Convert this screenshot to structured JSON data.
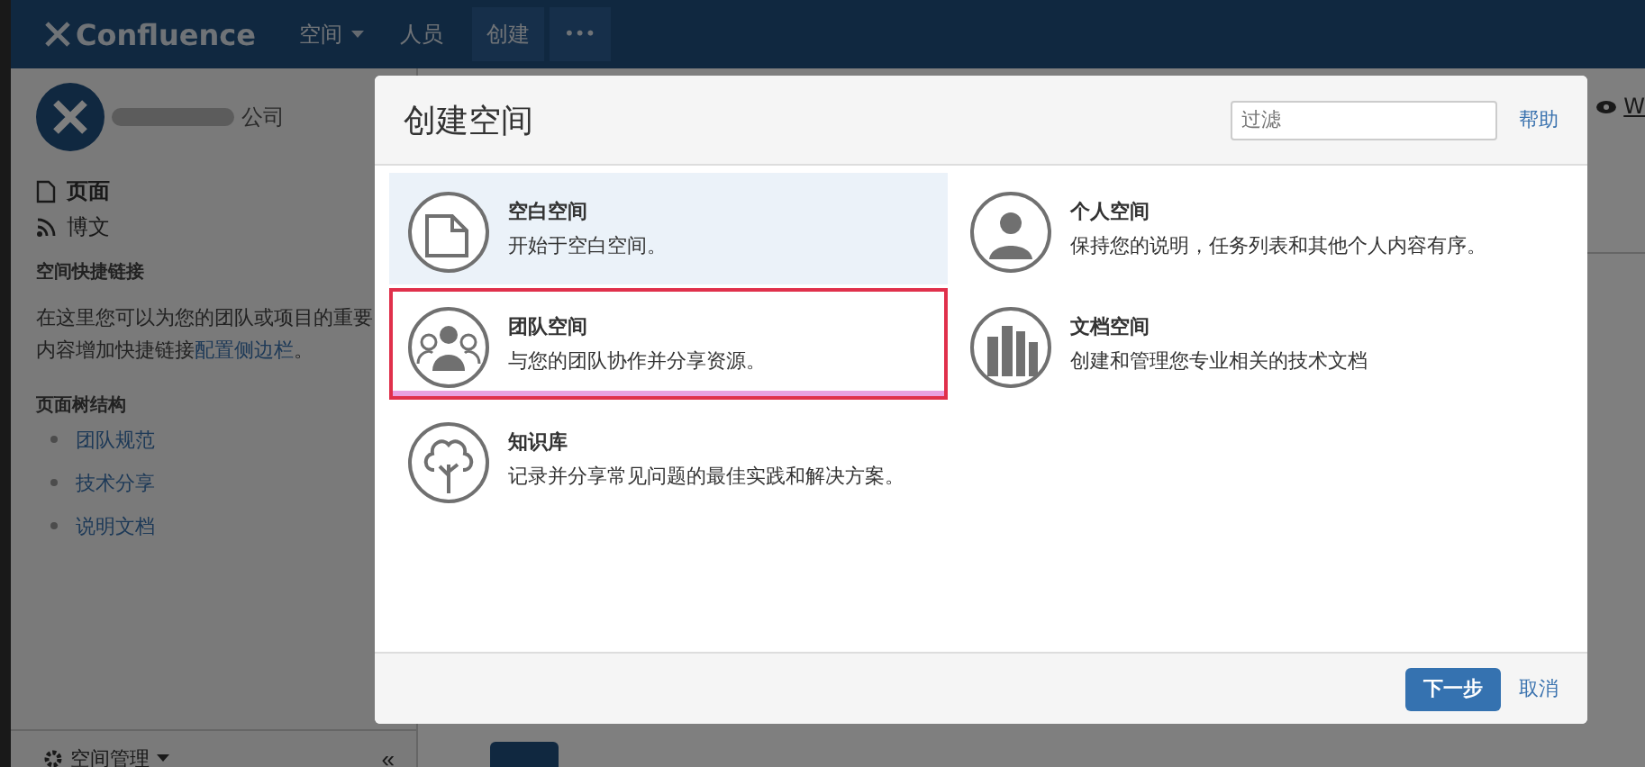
{
  "topbar": {
    "logo": "Confluence",
    "nav": [
      {
        "label": "空间",
        "dropdown": true
      },
      {
        "label": "人员",
        "dropdown": false
      }
    ],
    "create": "创建",
    "more": "•••"
  },
  "sidebar": {
    "space_name": "公司",
    "nav": [
      {
        "kind": "page",
        "label": "页面"
      },
      {
        "kind": "blog",
        "label": "博文"
      }
    ],
    "shortcuts_heading": "空间快捷链接",
    "shortcuts_line1": "在这里您可以为您的团队或项目的重要",
    "shortcuts_line2": "内容增加快捷链接",
    "shortcuts_link": "配置侧边栏",
    "shortcuts_end": "。",
    "tree_heading": "页面树结构",
    "tree": [
      "团队规范",
      "技术分享",
      "说明文档"
    ],
    "footer": "空间管理",
    "collapse": "«"
  },
  "right_link": "W",
  "dialog": {
    "title": "创建空间",
    "filter": {
      "placeholder": "过滤"
    },
    "help": "帮助",
    "options": [
      {
        "kind": "blank",
        "title": "空白空间",
        "description": "开始于空白空间。",
        "selected": true,
        "highlighted": false
      },
      {
        "kind": "personal",
        "title": "个人空间",
        "description": "保持您的说明，任务列表和其他个人内容有序。",
        "selected": false,
        "highlighted": false
      },
      {
        "kind": "team",
        "title": "团队空间",
        "description": "与您的团队协作并分享资源。",
        "selected": false,
        "highlighted": true
      },
      {
        "kind": "docs",
        "title": "文档空间",
        "description": "创建和管理您专业相关的技术文档",
        "selected": false,
        "highlighted": false
      },
      {
        "kind": "knowledge",
        "title": "知识库",
        "description": "记录并分享常见问题的最佳实践和解决方案。",
        "selected": false,
        "highlighted": false
      }
    ],
    "next": "下一步",
    "cancel": "取消"
  }
}
